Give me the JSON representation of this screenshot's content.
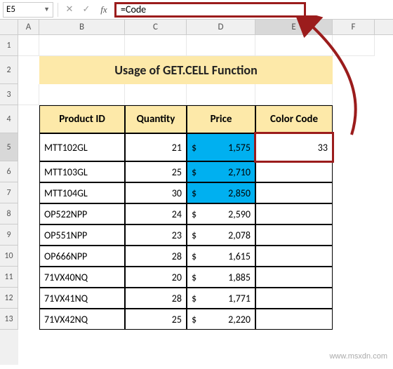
{
  "formula_bar": {
    "name_box": "E5",
    "formula": "=Code"
  },
  "columns": [
    "A",
    "B",
    "C",
    "D",
    "E",
    "F"
  ],
  "rows": [
    "1",
    "2",
    "3",
    "4",
    "5",
    "6",
    "7",
    "8",
    "9",
    "10",
    "11",
    "12",
    "13"
  ],
  "title": "Usage of GET.CELL Function",
  "headers": {
    "product_id": "Product ID",
    "quantity": "Quantity",
    "price": "Price",
    "color_code": "Color Code"
  },
  "table": [
    {
      "id": "MTT102GL",
      "qty": "21",
      "cur": "$",
      "price": "1,575",
      "blue": true
    },
    {
      "id": "MTT103GL",
      "qty": "25",
      "cur": "$",
      "price": "2,710",
      "blue": true
    },
    {
      "id": "MTT104GL",
      "qty": "30",
      "cur": "$",
      "price": "2,850",
      "blue": true
    },
    {
      "id": "OP522NPP",
      "qty": "24",
      "cur": "$",
      "price": "2,590",
      "blue": false
    },
    {
      "id": "OP551NPP",
      "qty": "23",
      "cur": "$",
      "price": "2,078",
      "blue": false
    },
    {
      "id": "OP666NPP",
      "qty": "28",
      "cur": "$",
      "price": "1,615",
      "blue": false
    },
    {
      "id": "71VX40NQ",
      "qty": "20",
      "cur": "$",
      "price": "1,885",
      "blue": false
    },
    {
      "id": "71VX41NQ",
      "qty": "28",
      "cur": "$",
      "price": "1,771",
      "blue": false
    },
    {
      "id": "71VX42NQ",
      "qty": "25",
      "cur": "$",
      "price": "2,220",
      "blue": false
    }
  ],
  "selected_value": "33",
  "watermark": "www.msxdn.com",
  "chart_data": {
    "type": "table",
    "title": "Usage of GET.CELL Function",
    "columns": [
      "Product ID",
      "Quantity",
      "Price",
      "Color Code"
    ],
    "rows": [
      [
        "MTT102GL",
        21,
        1575,
        33
      ],
      [
        "MTT103GL",
        25,
        2710,
        null
      ],
      [
        "MTT104GL",
        30,
        2850,
        null
      ],
      [
        "OP522NPP",
        24,
        2590,
        null
      ],
      [
        "OP551NPP",
        23,
        2078,
        null
      ],
      [
        "OP666NPP",
        28,
        1615,
        null
      ],
      [
        "71VX40NQ",
        20,
        1885,
        null
      ],
      [
        "71VX41NQ",
        28,
        1771,
        null
      ],
      [
        "71VX42NQ",
        25,
        2220,
        null
      ]
    ]
  }
}
